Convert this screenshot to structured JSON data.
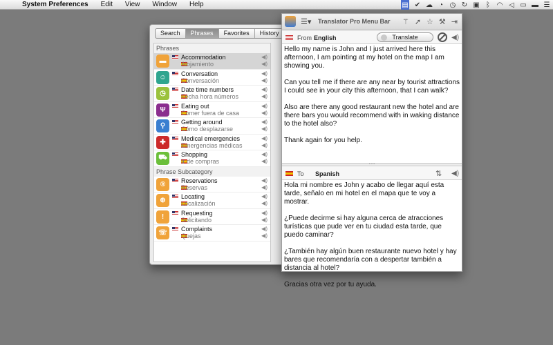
{
  "menubar": {
    "app_name": "System Preferences",
    "items": [
      "Edit",
      "View",
      "Window",
      "Help"
    ],
    "status_icons": [
      "translator-icon",
      "evernote-icon",
      "cloud-icon",
      "timer-icon",
      "clock-icon",
      "sync-icon",
      "lock-icon",
      "bluetooth-icon",
      "wifi-icon",
      "volume-icon",
      "display-icon",
      "battery-icon",
      "list-icon"
    ]
  },
  "left_panel": {
    "tabs": [
      {
        "label": "Search",
        "active": false
      },
      {
        "label": "Phrases",
        "active": true
      },
      {
        "label": "Favorites",
        "active": false
      },
      {
        "label": "History",
        "active": false
      }
    ],
    "section_phrases": "Phrases",
    "phrases": [
      {
        "en": "Accommodation",
        "es": "Alojamiento",
        "icon": "bed-icon",
        "color": "#f0a33a",
        "selected": true
      },
      {
        "en": "Conversation",
        "es": "Conversación",
        "icon": "chat-icon",
        "color": "#2fa58f",
        "selected": false
      },
      {
        "en": "Date time numbers",
        "es": "Fecha hora números",
        "icon": "clock-icon",
        "color": "#9bc23c",
        "selected": false
      },
      {
        "en": "Eating out",
        "es": "Comer fuera de casa",
        "icon": "fork-knife-icon",
        "color": "#8a2d8e",
        "selected": false
      },
      {
        "en": "Getting around",
        "es": "Cómo desplazarse",
        "icon": "bicycle-icon",
        "color": "#3a7fd0",
        "selected": false
      },
      {
        "en": "Medical emergencies",
        "es": "Emergencias médicas",
        "icon": "medical-cross-icon",
        "color": "#cc2a2a",
        "selected": false
      },
      {
        "en": "Shopping",
        "es": "Ir de compras",
        "icon": "cart-icon",
        "color": "#6bbf3a",
        "selected": false
      }
    ],
    "section_subcategory": "Phrase Subcategory",
    "subcategories": [
      {
        "en": "Reservations",
        "es": "Reservas",
        "icon": "reservation-icon",
        "color": "#f0a33a"
      },
      {
        "en": "Locating",
        "es": "Localización",
        "icon": "target-icon",
        "color": "#f0a33a"
      },
      {
        "en": "Requesting",
        "es": "Solicitando",
        "icon": "info-icon",
        "color": "#f0a33a"
      },
      {
        "en": "Complaints",
        "es": "Quejas",
        "icon": "phone-icon",
        "color": "#f0a33a"
      }
    ]
  },
  "right_panel": {
    "title": "Translator Pro Menu Bar",
    "from_label": "From",
    "from_language": "English",
    "translate_button": "Translate",
    "to_label": "To",
    "to_language": "Spanish",
    "source_text": "Hello my name is John and I just arrived here this afternoon, I am pointing at my hotel on the map I am showing you.\n\nCan you tell me if there are any near by tourist attractions I could see in your city this afternoon, that I can walk?\n\nAlso are there any good restaurant new the hotel and are there bars you would recommend with in waking distance to the hotel also?\n\nThank again for you help.",
    "translated_text": "Hola mi nombre es John y acabo de llegar aquí esta tarde, señalo en mi hotel en el mapa que te voy a mostrar.\n\n¿Puede decirme si hay alguna cerca de atracciones turísticas que pude ver en tu ciudad esta tarde, que puedo caminar?\n\n¿También hay algún buen restaurante nuevo hotel y hay bares que recomendaría con a despertar también a distancia al hotel?\n\nGracias otra vez por tu ayuda."
  }
}
